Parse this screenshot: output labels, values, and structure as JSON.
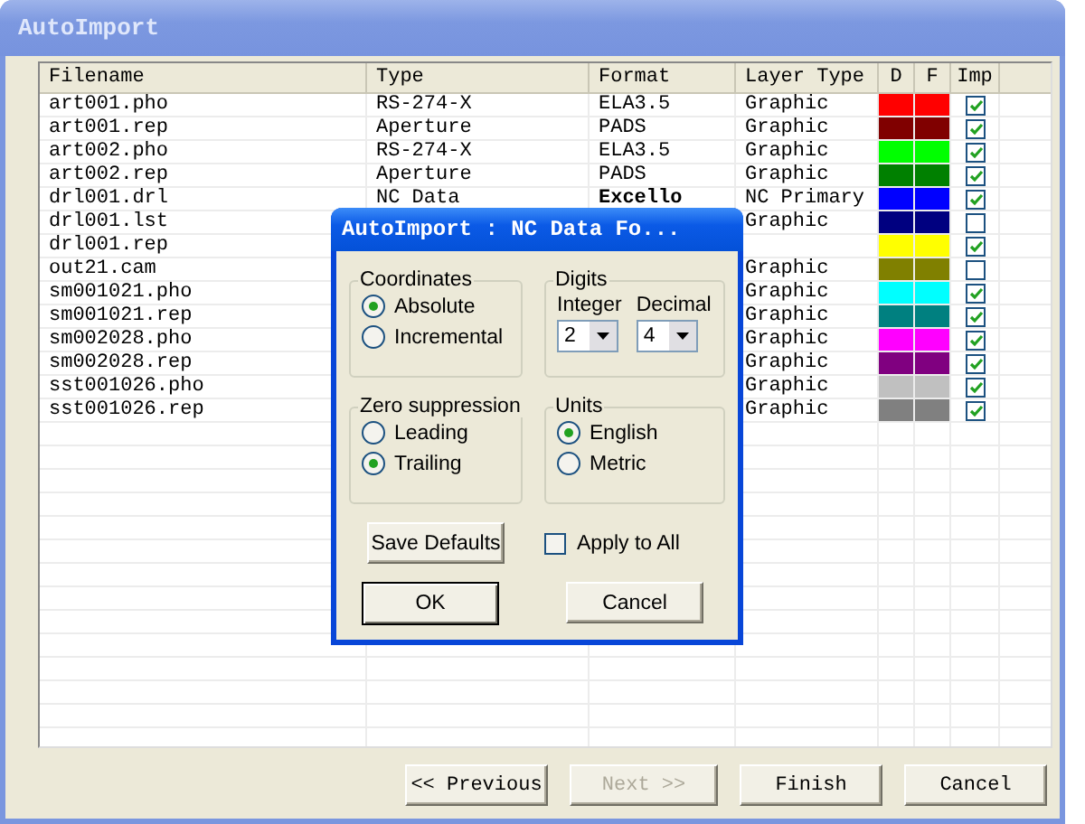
{
  "window": {
    "title": "AutoImport"
  },
  "table": {
    "columns": [
      "Filename",
      "Type",
      "Format",
      "Layer Type",
      "D",
      "F",
      "Imp"
    ],
    "rows": [
      {
        "filename": "art001.pho",
        "type": "RS-274-X",
        "format": "ELA3.5",
        "format_bold": false,
        "layer_type": "Graphic",
        "color": "#ff0000",
        "checked": true
      },
      {
        "filename": "art001.rep",
        "type": "Aperture",
        "format": "PADS",
        "format_bold": false,
        "layer_type": "Graphic",
        "color": "#800000",
        "checked": true
      },
      {
        "filename": "art002.pho",
        "type": "RS-274-X",
        "format": "ELA3.5",
        "format_bold": false,
        "layer_type": "Graphic",
        "color": "#00ff00",
        "checked": true
      },
      {
        "filename": "art002.rep",
        "type": "Aperture",
        "format": "PADS",
        "format_bold": false,
        "layer_type": "Graphic",
        "color": "#008000",
        "checked": true
      },
      {
        "filename": "drl001.drl",
        "type": "NC Data",
        "format": "Excello",
        "format_bold": true,
        "layer_type": "NC Primary",
        "color": "#0000ff",
        "checked": true
      },
      {
        "filename": "drl001.lst",
        "layer_type": "Graphic",
        "color": "#000080",
        "checked": false
      },
      {
        "filename": "drl001.rep",
        "color": "#ffff00",
        "checked": true
      },
      {
        "filename": "out21.cam",
        "layer_type": "Graphic",
        "color": "#808000",
        "checked": false
      },
      {
        "filename": "sm001021.pho",
        "layer_type": "Graphic",
        "color": "#00ffff",
        "checked": true
      },
      {
        "filename": "sm001021.rep",
        "layer_type": "Graphic",
        "color": "#008080",
        "checked": true
      },
      {
        "filename": "sm002028.pho",
        "layer_type": "Graphic",
        "color": "#ff00ff",
        "checked": true
      },
      {
        "filename": "sm002028.rep",
        "layer_type": "Graphic",
        "color": "#800080",
        "checked": true
      },
      {
        "filename": "sst001026.pho",
        "layer_type": "Graphic",
        "color": "#c0c0c0",
        "checked": true
      },
      {
        "filename": "sst001026.rep",
        "layer_type": "Graphic",
        "color": "#808080",
        "checked": true
      }
    ]
  },
  "dialog": {
    "title": "AutoImport : NC Data Fo...",
    "coordinates": {
      "label": "Coordinates",
      "options": [
        {
          "label": "Absolute",
          "selected": true
        },
        {
          "label": "Incremental",
          "selected": false
        }
      ]
    },
    "digits": {
      "label": "Digits",
      "integer": {
        "label": "Integer",
        "value": "2"
      },
      "decimal": {
        "label": "Decimal",
        "value": "4"
      }
    },
    "zero_suppression": {
      "label": "Zero suppression",
      "options": [
        {
          "label": "Leading",
          "selected": false
        },
        {
          "label": "Trailing",
          "selected": true
        }
      ]
    },
    "units": {
      "label": "Units",
      "options": [
        {
          "label": "English",
          "selected": true
        },
        {
          "label": "Metric",
          "selected": false
        }
      ]
    },
    "save_defaults": "Save Defaults",
    "apply_to_all": {
      "label": "Apply to All",
      "checked": false
    },
    "buttons": [
      {
        "label": "OK",
        "default": true
      },
      {
        "label": "Cancel",
        "default": false
      }
    ]
  },
  "footer_buttons": [
    {
      "label": "<< Previous",
      "disabled": false
    },
    {
      "label": "Next >>",
      "disabled": true
    },
    {
      "label": "Finish",
      "disabled": false
    },
    {
      "label": "Cancel",
      "disabled": false
    }
  ]
}
